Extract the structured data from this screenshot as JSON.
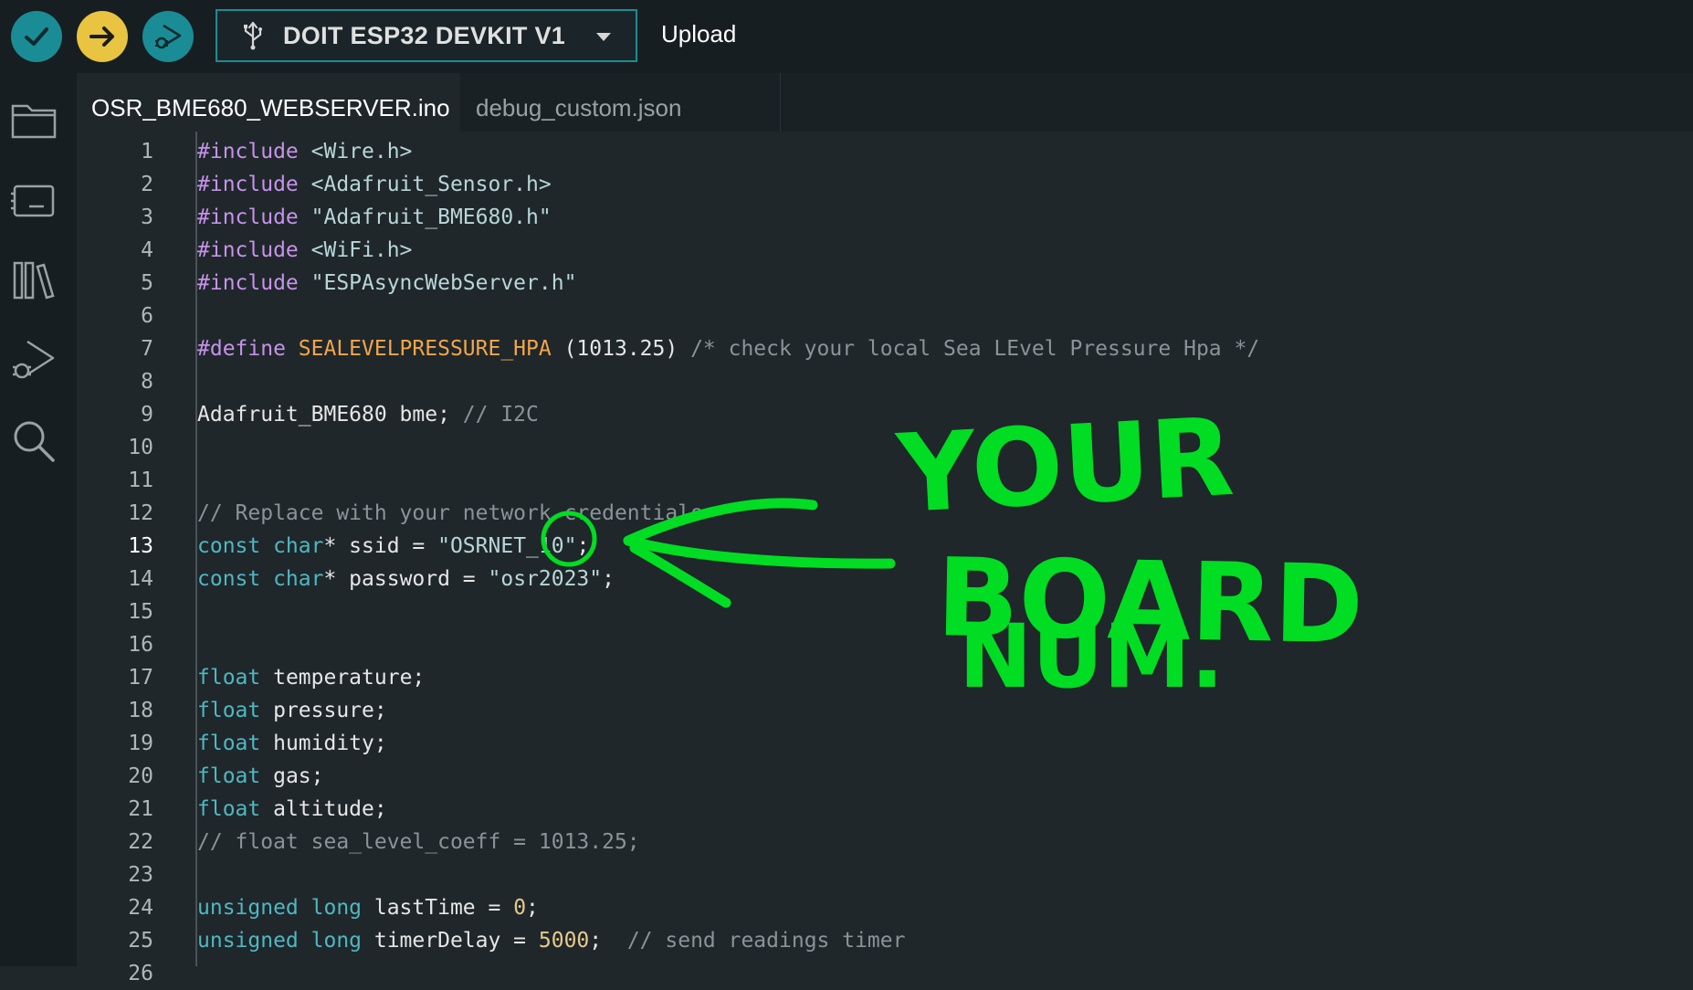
{
  "toolbar": {
    "verify_icon": "checkmark-icon",
    "upload_icon": "arrow-right-icon",
    "debug_icon": "debug-play-icon",
    "board_name": "DOIT ESP32 DEVKIT V1",
    "board_icon": "usb-icon",
    "hover_label": "Upload"
  },
  "sidebar": {
    "items": [
      {
        "icon": "folder-icon"
      },
      {
        "icon": "board-manager-icon"
      },
      {
        "icon": "library-icon"
      },
      {
        "icon": "debug-icon"
      },
      {
        "icon": "search-icon"
      }
    ]
  },
  "tabs": [
    {
      "label": "OSR_BME680_WEBSERVER.ino",
      "active": true
    },
    {
      "label": "debug_custom.json",
      "active": false
    }
  ],
  "editor": {
    "active_line": 13,
    "lines": [
      {
        "n": "1",
        "parts": [
          {
            "c": "inc",
            "t": "#include "
          },
          {
            "c": "str",
            "t": "<Wire.h>"
          }
        ]
      },
      {
        "n": "2",
        "parts": [
          {
            "c": "inc",
            "t": "#include "
          },
          {
            "c": "str",
            "t": "<Adafruit_Sensor.h>"
          }
        ]
      },
      {
        "n": "3",
        "parts": [
          {
            "c": "inc",
            "t": "#include "
          },
          {
            "c": "str",
            "t": "\"Adafruit_BME680.h\""
          }
        ]
      },
      {
        "n": "4",
        "parts": [
          {
            "c": "inc",
            "t": "#include "
          },
          {
            "c": "str",
            "t": "<WiFi.h>"
          }
        ]
      },
      {
        "n": "5",
        "parts": [
          {
            "c": "inc",
            "t": "#include "
          },
          {
            "c": "str",
            "t": "\"ESPAsyncWebServer.h\""
          }
        ]
      },
      {
        "n": "6",
        "parts": []
      },
      {
        "n": "7",
        "parts": [
          {
            "c": "inc",
            "t": "#define "
          },
          {
            "c": "macro",
            "t": "SEALEVELPRESSURE_HPA"
          },
          {
            "c": "plain",
            "t": " (1013.25) "
          },
          {
            "c": "comment",
            "t": "/* check your local Sea LEvel Pressure Hpa */"
          }
        ]
      },
      {
        "n": "8",
        "parts": []
      },
      {
        "n": "9",
        "parts": [
          {
            "c": "plain",
            "t": "Adafruit_BME680 bme; "
          },
          {
            "c": "comment",
            "t": "// I2C"
          }
        ]
      },
      {
        "n": "10",
        "parts": []
      },
      {
        "n": "11",
        "parts": []
      },
      {
        "n": "12",
        "parts": [
          {
            "c": "comment",
            "t": "// Replace with your network credentials"
          }
        ]
      },
      {
        "n": "13",
        "parts": [
          {
            "c": "type",
            "t": "const char"
          },
          {
            "c": "plain",
            "t": "* ssid = "
          },
          {
            "c": "str",
            "t": "\"OSRNET_10\""
          },
          {
            "c": "plain",
            "t": ";"
          }
        ]
      },
      {
        "n": "14",
        "parts": [
          {
            "c": "type",
            "t": "const char"
          },
          {
            "c": "plain",
            "t": "* password = "
          },
          {
            "c": "str",
            "t": "\"osr2023\""
          },
          {
            "c": "plain",
            "t": ";"
          }
        ]
      },
      {
        "n": "15",
        "parts": []
      },
      {
        "n": "16",
        "parts": []
      },
      {
        "n": "17",
        "parts": [
          {
            "c": "type",
            "t": "float"
          },
          {
            "c": "plain",
            "t": " temperature;"
          }
        ]
      },
      {
        "n": "18",
        "parts": [
          {
            "c": "type",
            "t": "float"
          },
          {
            "c": "plain",
            "t": " pressure;"
          }
        ]
      },
      {
        "n": "19",
        "parts": [
          {
            "c": "type",
            "t": "float"
          },
          {
            "c": "plain",
            "t": " humidity;"
          }
        ]
      },
      {
        "n": "20",
        "parts": [
          {
            "c": "type",
            "t": "float"
          },
          {
            "c": "plain",
            "t": " gas;"
          }
        ]
      },
      {
        "n": "21",
        "parts": [
          {
            "c": "type",
            "t": "float"
          },
          {
            "c": "plain",
            "t": " altitude;"
          }
        ]
      },
      {
        "n": "22",
        "parts": [
          {
            "c": "comment",
            "t": "// float sea_level_coeff = 1013.25;"
          }
        ]
      },
      {
        "n": "23",
        "parts": []
      },
      {
        "n": "24",
        "parts": [
          {
            "c": "type",
            "t": "unsigned long"
          },
          {
            "c": "plain",
            "t": " lastTime = "
          },
          {
            "c": "num",
            "t": "0"
          },
          {
            "c": "plain",
            "t": ";"
          }
        ]
      },
      {
        "n": "25",
        "parts": [
          {
            "c": "type",
            "t": "unsigned long"
          },
          {
            "c": "plain",
            "t": " timerDelay = "
          },
          {
            "c": "num",
            "t": "5000"
          },
          {
            "c": "plain",
            "t": ";  "
          },
          {
            "c": "comment",
            "t": "// send readings timer"
          }
        ]
      },
      {
        "n": "26",
        "parts": []
      }
    ]
  },
  "annotation": {
    "text_lines": [
      "YOUR",
      "BOARD",
      "NUM."
    ],
    "color": "#00dd22",
    "target": "ssid-number-10"
  }
}
